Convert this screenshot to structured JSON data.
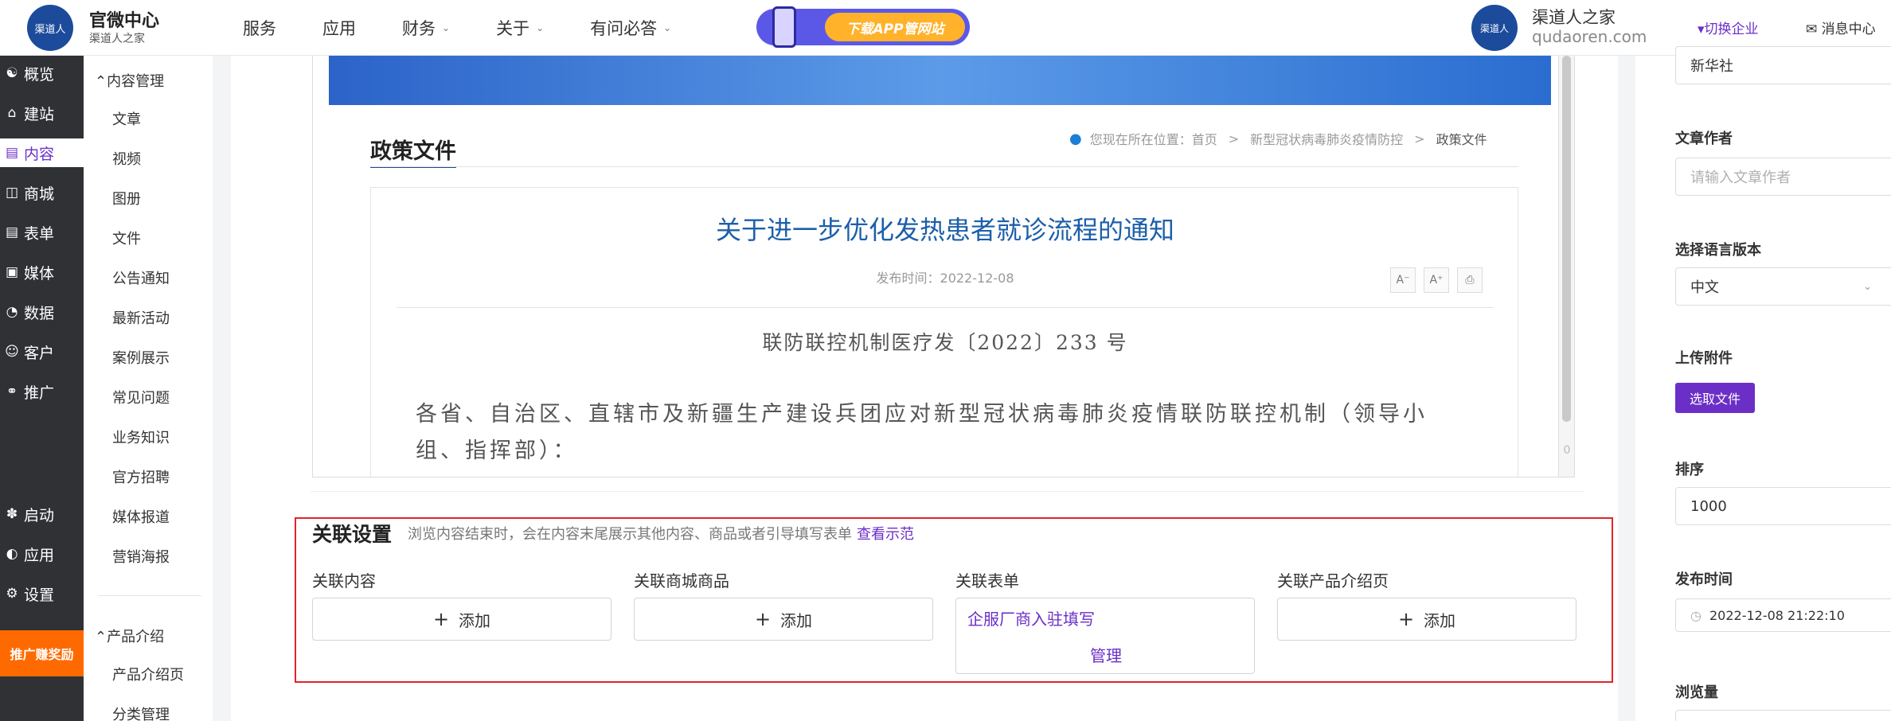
{
  "brand": {
    "logo_text": "渠道人",
    "title": "官微中心",
    "subtitle": "渠道人之家"
  },
  "nav": [
    {
      "label": "服务",
      "has_dropdown": false
    },
    {
      "label": "应用",
      "has_dropdown": false
    },
    {
      "label": "财务",
      "has_dropdown": true
    },
    {
      "label": "关于",
      "has_dropdown": true
    },
    {
      "label": "有问必答",
      "has_dropdown": true
    }
  ],
  "promo": {
    "button_label": "下载APP管网站"
  },
  "account": {
    "logo_text": "渠道人",
    "name": "渠道人之家",
    "domain": "qudaoren.com",
    "switch_label": "▾切换企业",
    "messages_label": "消息中心"
  },
  "sidebar": {
    "items": [
      {
        "label": "概览",
        "icon": "storefront-icon"
      },
      {
        "label": "建站",
        "icon": "home-icon"
      },
      {
        "label": "内容",
        "icon": "document-icon",
        "active": true
      },
      {
        "label": "商城",
        "icon": "shop-icon"
      },
      {
        "label": "表单",
        "icon": "form-icon"
      },
      {
        "label": "媒体",
        "icon": "video-icon"
      },
      {
        "label": "数据",
        "icon": "chart-icon"
      },
      {
        "label": "客户",
        "icon": "user-icon"
      },
      {
        "label": "推广",
        "icon": "paperclip-icon"
      },
      {
        "label": "启动",
        "icon": "launch-icon"
      },
      {
        "label": "应用",
        "icon": "apps-icon"
      },
      {
        "label": "设置",
        "icon": "gear-icon"
      }
    ],
    "promo_label": "推广赚奖励"
  },
  "subsidebar": {
    "groups": [
      {
        "label": "内容管理",
        "items": [
          "文章",
          "视频",
          "图册",
          "文件",
          "公告通知",
          "最新活动",
          "案例展示",
          "常见问题",
          "业务知识",
          "官方招聘",
          "媒体报道",
          "营销海报"
        ]
      },
      {
        "label": "产品介绍",
        "items": [
          "产品介绍页",
          "分类管理"
        ]
      }
    ]
  },
  "preview": {
    "section_title": "政策文件",
    "breadcrumb": {
      "prefix": "您现在所在位置：",
      "home": "首页",
      "category": "新型冠状病毒肺炎疫情防控",
      "current": "政策文件"
    },
    "article_title": "关于进一步优化发热患者就诊流程的通知",
    "publish_prefix": "发布时间：",
    "publish_date": "2022-12-08",
    "doc_number": "联防联控机制医疗发〔2022〕233 号",
    "body": "各省、自治区、直辖市及新疆生产建设兵团应对新型冠状病毒肺炎疫情联防联控机制（领导小组、指挥部）：",
    "scroll_count": "0"
  },
  "relate": {
    "title": "关联设置",
    "description": "浏览内容结束时，会在内容末尾展示其他内容、商品或者引导填写表单",
    "demo_link": "查看示范",
    "columns": {
      "content": {
        "label": "关联内容",
        "button": "添加"
      },
      "shop": {
        "label": "关联商城商品",
        "button": "添加"
      },
      "form": {
        "label": "关联表单",
        "link": "企服厂商入驻填写",
        "manage": "管理"
      },
      "product": {
        "label": "关联产品介绍页",
        "button": "添加"
      }
    }
  },
  "rightpanel": {
    "source_value": "新华社",
    "author_label": "文章作者",
    "author_placeholder": "请输入文章作者",
    "language_label": "选择语言版本",
    "language_value": "中文",
    "attachment_label": "上传附件",
    "attachment_button": "选取文件",
    "sort_label": "排序",
    "sort_value": "1000",
    "publish_label": "发布时间",
    "publish_value": "2022-12-08 21:22:10",
    "views_label": "浏览量"
  },
  "colors": {
    "accent": "#6b2fc7",
    "sidebar_bg": "#2f3135",
    "title_blue": "#1c5fa9",
    "highlight_red": "#e0242b"
  }
}
